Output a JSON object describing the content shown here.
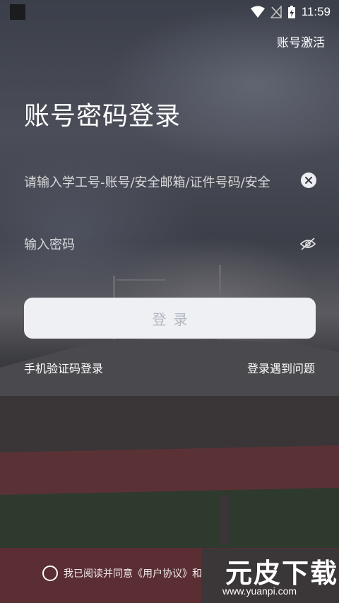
{
  "status_bar": {
    "time": "11:59"
  },
  "header": {
    "activate_label": "账号激活"
  },
  "page": {
    "title": "账号密码登录"
  },
  "form": {
    "account_placeholder": "请输入学工号-账号/安全邮箱/证件号码/安全",
    "password_placeholder": "输入密码",
    "login_label": "登录"
  },
  "links": {
    "sms_login": "手机验证码登录",
    "problem": "登录遇到问题"
  },
  "agreement": {
    "text": "我已阅读并同意《用户协议》和"
  },
  "watermark": {
    "logo": "元皮下载",
    "url": "www.yuanpi.com"
  },
  "colors": {
    "login_button_bg": "#eef0f4",
    "login_button_text": "#b3b8c0",
    "watermark_bg": "#373737"
  }
}
